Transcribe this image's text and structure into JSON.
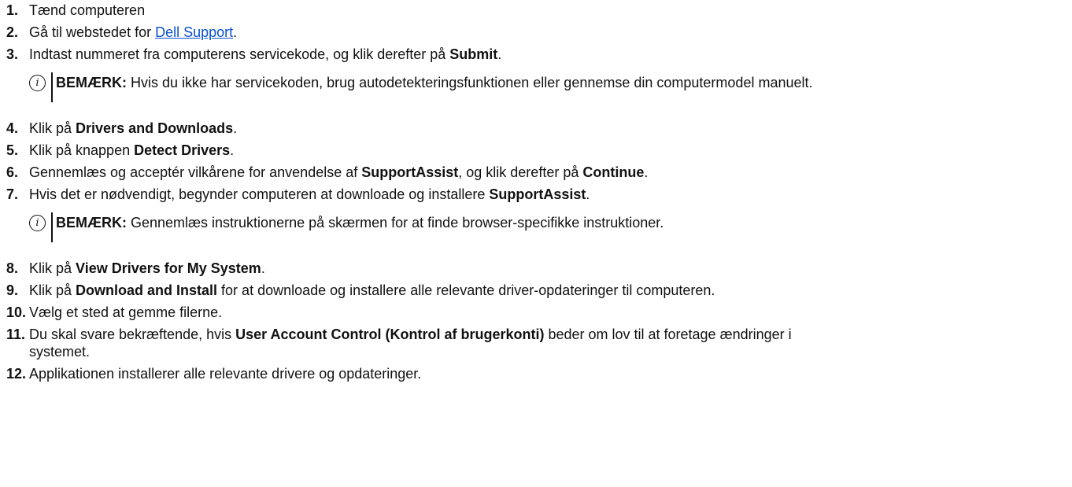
{
  "steps": [
    {
      "num": "1.",
      "text": "Tænd computeren"
    },
    {
      "num": "2.",
      "pre": "Gå til webstedet for ",
      "link": "Dell Support",
      "post": "."
    },
    {
      "num": "3.",
      "pre": "Indtast nummeret fra computerens servicekode, og klik derefter på ",
      "bold": "Submit",
      "post": "."
    },
    {
      "num": "4.",
      "pre": "Klik på ",
      "bold": "Drivers and Downloads",
      "post": "."
    },
    {
      "num": "5.",
      "pre": "Klik på knappen ",
      "bold": "Detect Drivers",
      "post": "."
    },
    {
      "num": "6.",
      "pre": "Gennemlæs og acceptér vilkårene for anvendelse af ",
      "bold": "SupportAssist",
      "mid": ", og klik derefter på ",
      "bold2": "Continue",
      "post": "."
    },
    {
      "num": "7.",
      "pre": "Hvis det er nødvendigt, begynder computeren at downloade og installere ",
      "bold": "SupportAssist",
      "post": "."
    },
    {
      "num": "8.",
      "pre": "Klik på ",
      "bold": "View Drivers for My System",
      "post": "."
    },
    {
      "num": "9.",
      "pre": "Klik på ",
      "bold": "Download and Install",
      "post": " for at downloade og installere alle relevante driver-opdateringer til computeren."
    },
    {
      "num": "10.",
      "text": "Vælg et sted at gemme filerne."
    },
    {
      "num": "11.",
      "pre": "Du skal svare bekræftende, hvis ",
      "bold": "User Account Control (Kontrol af brugerkonti)",
      "post": " beder om lov til at foretage ændringer i",
      "line2": "systemet."
    },
    {
      "num": "12.",
      "text": "Applikationen installerer alle relevante drivere og opdateringer."
    }
  ],
  "notes": [
    {
      "label": "BEMÆRK:",
      "text": " Hvis du ikke har servicekoden, brug autodetekteringsfunktionen eller gennemse din computermodel manuelt."
    },
    {
      "label": "BEMÆRK:",
      "text": " Gennemlæs instruktionerne på skærmen for at finde browser-specifikke instruktioner."
    }
  ],
  "icons": {
    "note": "info-icon"
  },
  "note_icon_glyph": "i"
}
